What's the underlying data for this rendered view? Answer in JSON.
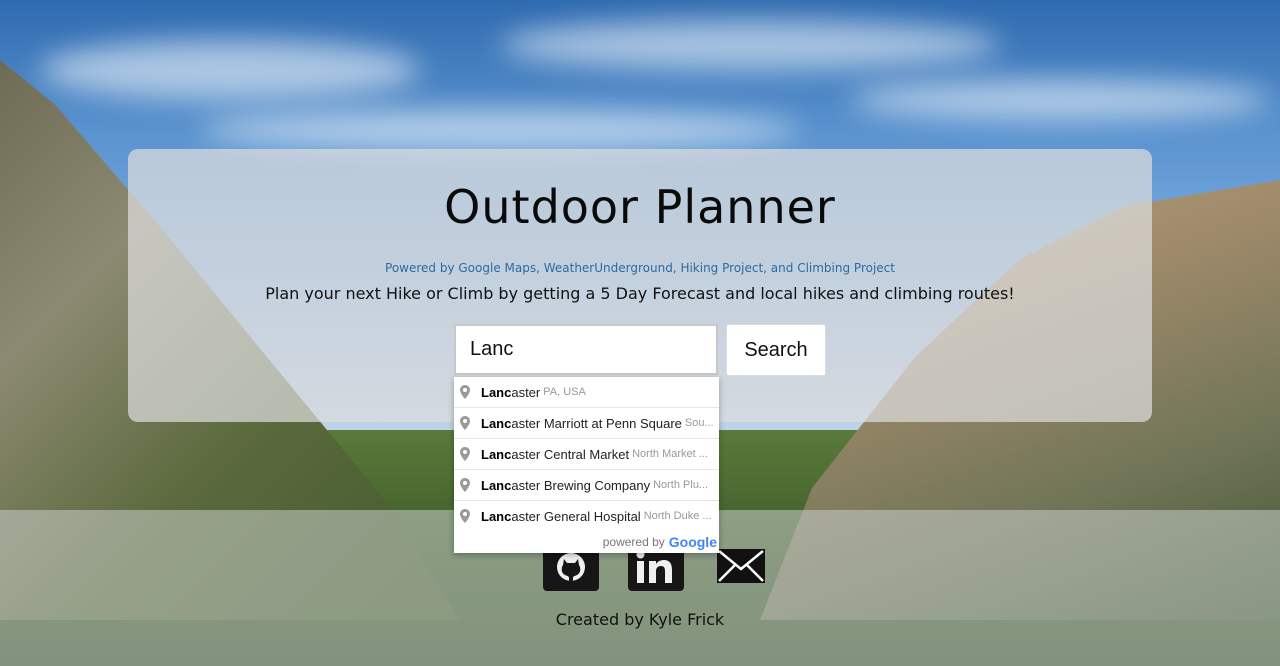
{
  "header": {
    "title": "Outdoor Planner",
    "powered_by": "Powered by Google Maps, WeatherUnderground, Hiking Project, and Climbing Project",
    "tagline": "Plan your next Hike or Climb by getting a 5 Day Forecast and local hikes and climbing routes!"
  },
  "search": {
    "value": "Lanc",
    "button_label": "Search"
  },
  "autocomplete": {
    "items": [
      {
        "match": "Lanc",
        "rest": "aster",
        "secondary": "PA, USA"
      },
      {
        "match": "Lanc",
        "rest": "aster Marriott at Penn Square",
        "secondary": "Sou..."
      },
      {
        "match": "Lanc",
        "rest": "aster Central Market",
        "secondary": "North Market ..."
      },
      {
        "match": "Lanc",
        "rest": "aster Brewing Company",
        "secondary": "North Plu..."
      },
      {
        "match": "Lanc",
        "rest": "aster General Hospital",
        "secondary": "North Duke ..."
      }
    ],
    "powered_by": "powered by",
    "brand": "Google"
  },
  "footer": {
    "credit": "Created by Kyle Frick",
    "icons": [
      "github-icon",
      "linkedin-icon",
      "mail-icon"
    ]
  },
  "colors": {
    "panel": "#dcdcdc",
    "link_blue": "#2e6a9e"
  }
}
